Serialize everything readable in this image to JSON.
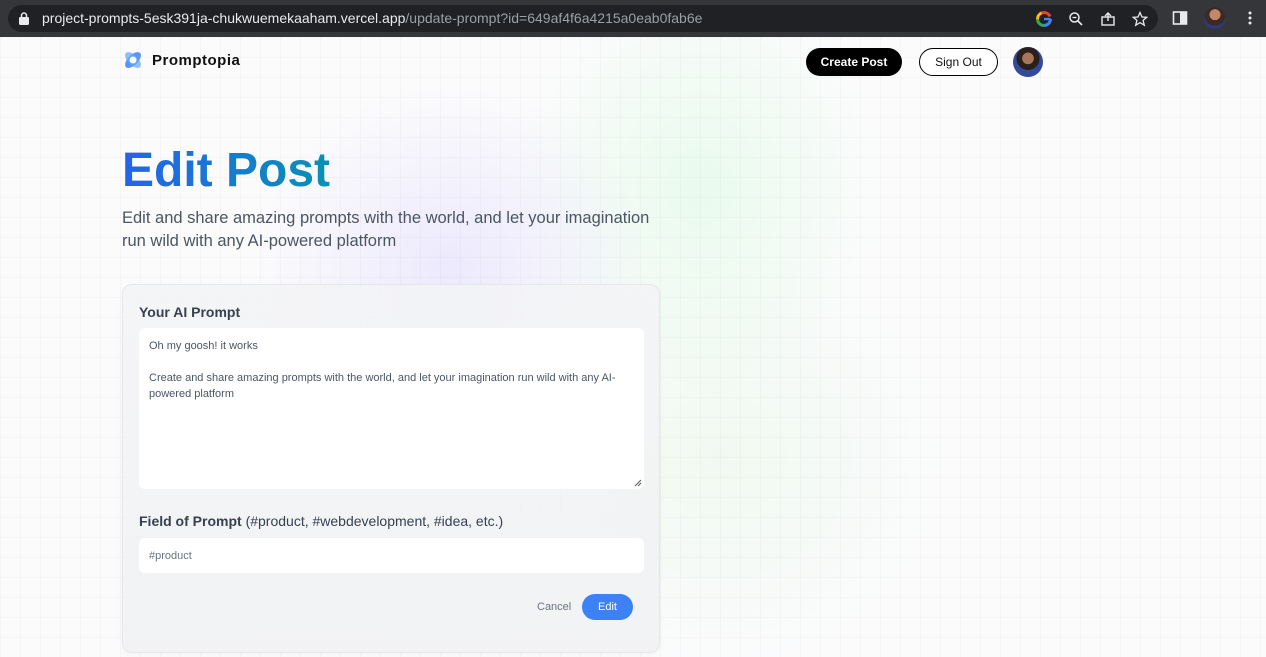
{
  "browser": {
    "url_host": "project-prompts-5esk391ja-chukwuemekaaham.vercel.app",
    "url_path": "/update-prompt?id=649af4f6a4215a0eab0fab6e",
    "icons": [
      "google-icon",
      "zoom-icon",
      "share-icon",
      "star-icon",
      "sidepanel-icon",
      "profile-avatar",
      "menu-icon"
    ]
  },
  "nav": {
    "brand": "Promptopia",
    "create_post": "Create Post",
    "sign_out": "Sign Out"
  },
  "header": {
    "title": "Edit Post",
    "subtitle": "Edit and share amazing prompts with the world, and let your imagination run wild with any AI-powered platform"
  },
  "form": {
    "prompt_label": "Your AI Prompt",
    "prompt_value": "Oh my goosh! it works\n\nCreate and share amazing prompts with the world, and let your imagination run wild with any AI-powered platform",
    "tag_label": "Field of Prompt",
    "tag_hint": "(#product, #webdevelopment, #idea, etc.)",
    "tag_value": "#product",
    "cancel": "Cancel",
    "submit": "Edit"
  },
  "colors": {
    "title_gradient_start": "#2563eb",
    "title_gradient_end": "#0891b2",
    "primary_button": "#3b82f6",
    "create_button": "#000000"
  }
}
